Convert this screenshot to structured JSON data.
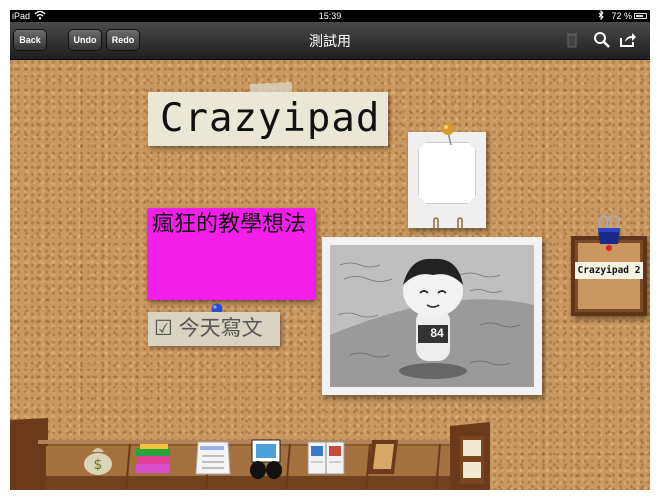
{
  "status_bar": {
    "carrier": "iPad",
    "time": "15:39",
    "battery": "72 %"
  },
  "toolbar": {
    "back_label": "Back",
    "undo_label": "Undo",
    "redo_label": "Redo",
    "title": "測試用"
  },
  "board": {
    "title_note": "Crazyipad",
    "pink_note": "瘋狂的教學想法",
    "todo_note": "☑ 今天寫文",
    "folder_label": "Crazyipad 2",
    "photo_number": "84"
  },
  "colors": {
    "cork": "#c9975f",
    "pink_note": "#f31fe8",
    "toolbar": "#2e2e2e"
  },
  "shelf": {
    "items": [
      "money-bag-icon",
      "books-icon",
      "checklist-icon",
      "photo-album-icon",
      "magazine-icon",
      "frame-icon",
      "drawer-icon"
    ]
  }
}
